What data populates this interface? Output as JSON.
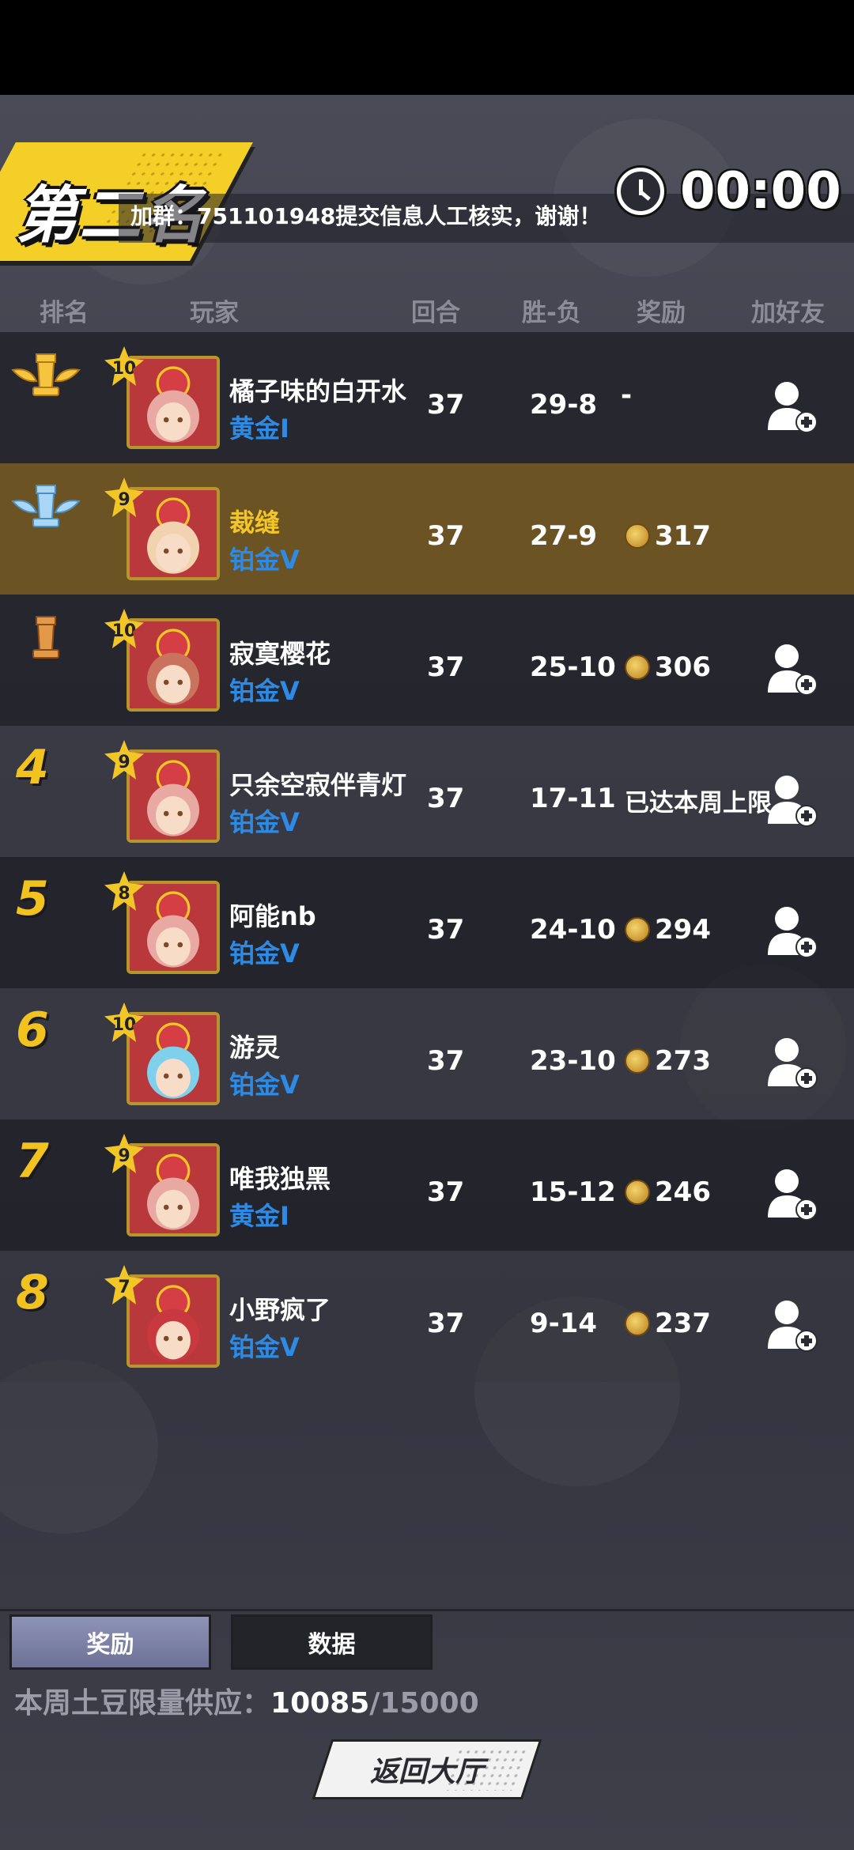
{
  "rank_banner": {
    "title": "第二名"
  },
  "notice": "加群：751101948提交信息人工核实，谢谢！",
  "timer": {
    "value": "00:00"
  },
  "header": {
    "rank": "排名",
    "player": "玩家",
    "rounds": "回合",
    "win_loss": "胜-负",
    "reward": "奖励",
    "add_friend": "加好友"
  },
  "rows": [
    {
      "rank": "1",
      "level": "10",
      "name": "橘子味的白开水",
      "tier": "黄金I",
      "rounds": "37",
      "wl": "29-8",
      "reward": "-",
      "has_coin": false,
      "add_friend": true,
      "self": false
    },
    {
      "rank": "2",
      "level": "9",
      "name": "裁缝",
      "tier": "铂金V",
      "rounds": "37",
      "wl": "27-9",
      "reward": "317",
      "has_coin": true,
      "add_friend": false,
      "self": true
    },
    {
      "rank": "3",
      "level": "10",
      "name": "寂寞樱花",
      "tier": "铂金V",
      "rounds": "37",
      "wl": "25-10",
      "reward": "306",
      "has_coin": true,
      "add_friend": true,
      "self": false
    },
    {
      "rank": "4",
      "level": "9",
      "name": "只余空寂伴青灯",
      "tier": "铂金V",
      "rounds": "37",
      "wl": "17-11",
      "reward": "已达本周上限",
      "has_coin": false,
      "add_friend": true,
      "self": false
    },
    {
      "rank": "5",
      "level": "8",
      "name": "阿能nb",
      "tier": "铂金V",
      "rounds": "37",
      "wl": "24-10",
      "reward": "294",
      "has_coin": true,
      "add_friend": true,
      "self": false
    },
    {
      "rank": "6",
      "level": "10",
      "name": "游灵",
      "tier": "铂金V",
      "rounds": "37",
      "wl": "23-10",
      "reward": "273",
      "has_coin": true,
      "add_friend": true,
      "self": false
    },
    {
      "rank": "7",
      "level": "9",
      "name": "唯我独黑",
      "tier": "黄金I",
      "rounds": "37",
      "wl": "15-12",
      "reward": "246",
      "has_coin": true,
      "add_friend": true,
      "self": false
    },
    {
      "rank": "8",
      "level": "7",
      "name": "小野疯了",
      "tier": "铂金V",
      "rounds": "37",
      "wl": "9-14",
      "reward": "237",
      "has_coin": true,
      "add_friend": true,
      "self": false
    }
  ],
  "tabs": {
    "rewards": "奖励",
    "data": "数据"
  },
  "supply": {
    "label": "本周土豆限量供应：",
    "current": "10085",
    "limit": "/15000"
  },
  "back_button": "返回大厅",
  "colors": {
    "gold": "#f3c628",
    "tier_blue": "#2d8be6",
    "self_row": "#6b5323"
  }
}
